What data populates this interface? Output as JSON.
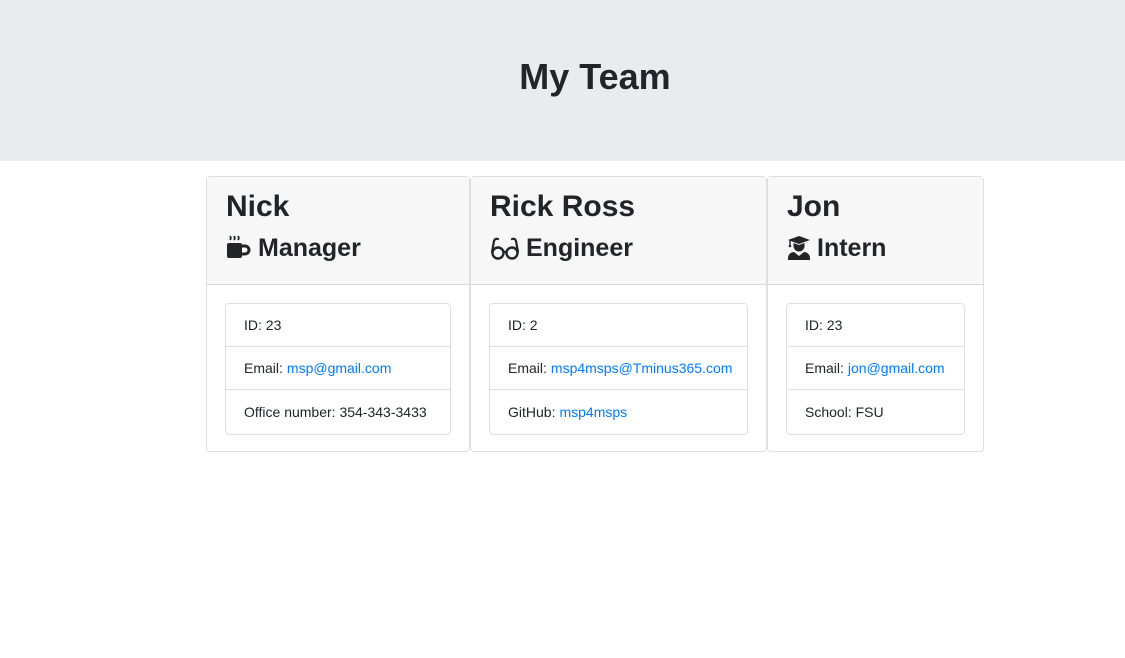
{
  "header": {
    "title": "My Team",
    "background_color": "#e9ecef"
  },
  "link_color": "#007bff",
  "cards": [
    {
      "name": "Nick",
      "role": "Manager",
      "role_icon": "coffee-mug-icon",
      "details": [
        {
          "label": "ID: 23",
          "value": ""
        },
        {
          "label": "Email:",
          "value": "msp@gmail.com"
        },
        {
          "label": "Office number: 354-343-3433",
          "value": ""
        }
      ]
    },
    {
      "name": "Rick Ross",
      "role": "Engineer",
      "role_icon": "glasses-icon",
      "details": [
        {
          "label": "ID: 2",
          "value": ""
        },
        {
          "label": "Email:",
          "value": "msp4msps@Tminus365.com"
        },
        {
          "label": "GitHub:",
          "value": "msp4msps"
        }
      ]
    },
    {
      "name": "Jon",
      "role": "Intern",
      "role_icon": "graduate-icon",
      "details": [
        {
          "label": "ID: 23",
          "value": ""
        },
        {
          "label": "Email:",
          "value": "jon@gmail.com"
        },
        {
          "label": "School: FSU",
          "value": ""
        }
      ]
    }
  ]
}
